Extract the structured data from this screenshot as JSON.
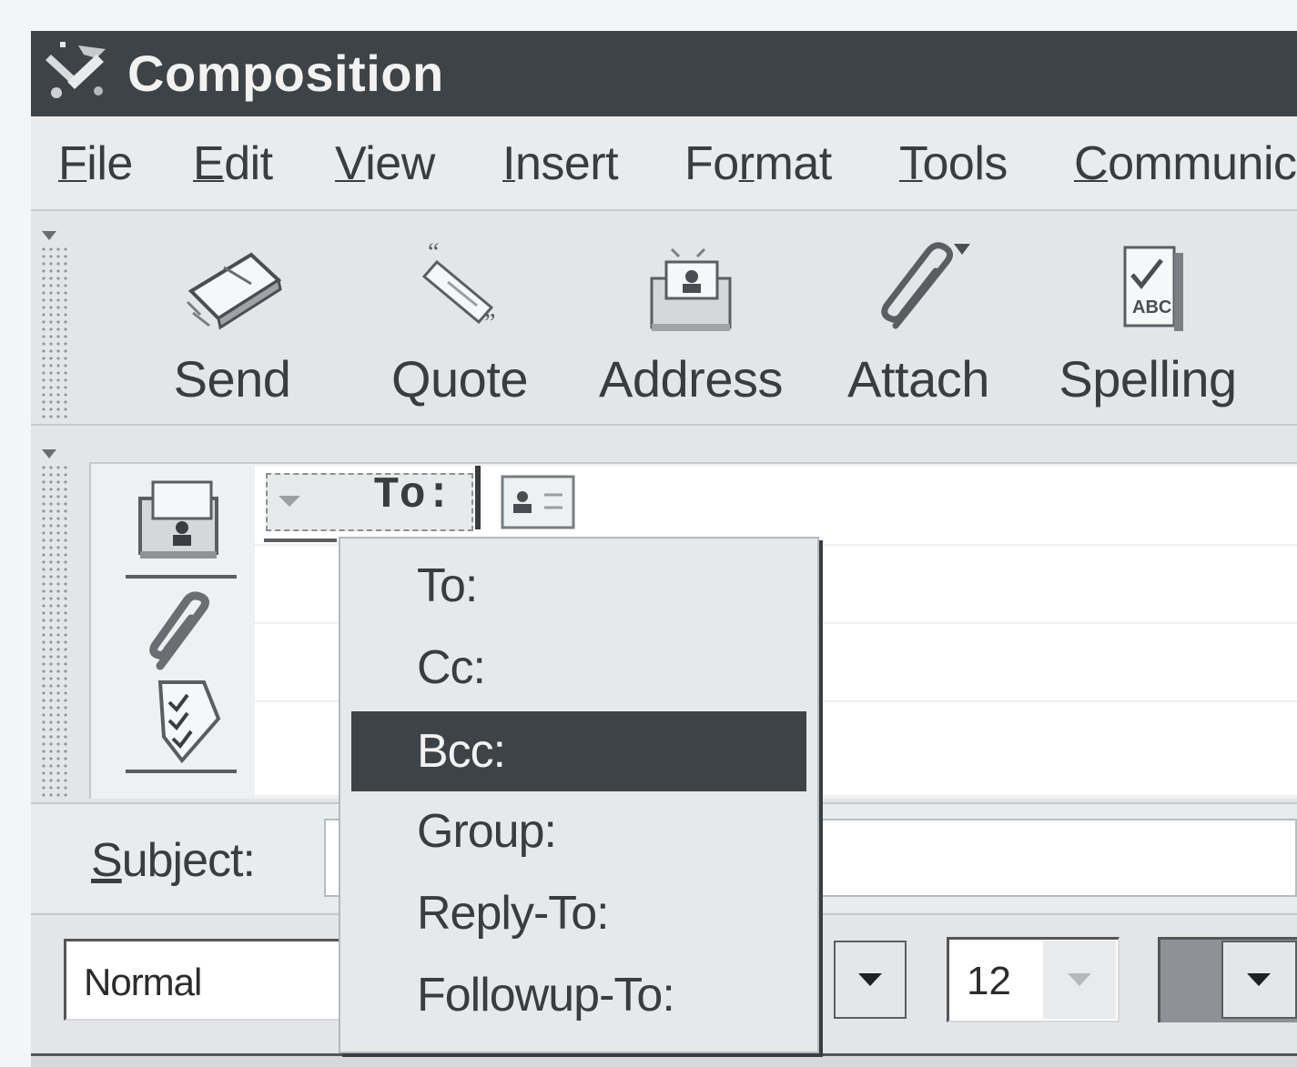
{
  "window": {
    "title": "Composition"
  },
  "menubar": {
    "items": [
      {
        "pre": "",
        "accel": "F",
        "post": "ile"
      },
      {
        "pre": "",
        "accel": "E",
        "post": "dit"
      },
      {
        "pre": "",
        "accel": "V",
        "post": "iew"
      },
      {
        "pre": "",
        "accel": "I",
        "post": "nsert"
      },
      {
        "pre": "Fo",
        "accel": "r",
        "post": "mat"
      },
      {
        "pre": "",
        "accel": "T",
        "post": "ools"
      },
      {
        "pre": "",
        "accel": "C",
        "post": "ommunic"
      }
    ]
  },
  "toolbar": {
    "buttons": [
      {
        "label": "Send",
        "icon": "send-icon"
      },
      {
        "label": "Quote",
        "icon": "quote-icon"
      },
      {
        "label": "Address",
        "icon": "address-book-icon"
      },
      {
        "label": "Attach",
        "icon": "paperclip-icon"
      },
      {
        "label": "Spelling",
        "icon": "spellcheck-icon"
      }
    ]
  },
  "address": {
    "type_label": "To:",
    "menu_options": [
      "To:",
      "Cc:",
      "Bcc:",
      "Group:",
      "Reply-To:",
      "Followup-To:"
    ],
    "highlighted_option": "Bcc:"
  },
  "subject": {
    "label_accel": "S",
    "label_rest": "ubject:",
    "value": ""
  },
  "format": {
    "paragraph_style": "Normal",
    "font_size": "12"
  },
  "colors": {
    "titlebar": "#3d4346",
    "highlight": "#3d4346",
    "highlight_text": "#f2f2f2"
  }
}
